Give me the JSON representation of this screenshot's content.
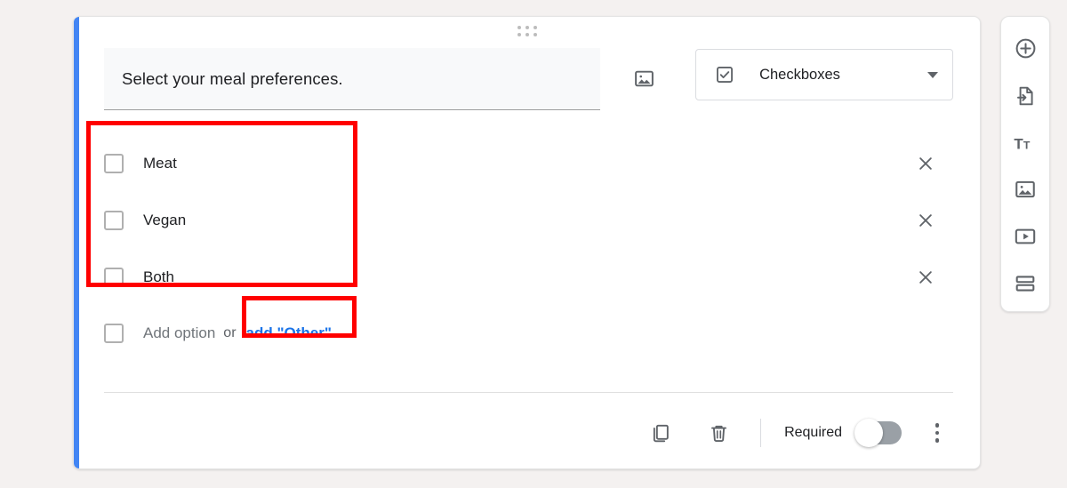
{
  "card": {
    "drag_handle_icon": "drag-dots-icon",
    "question": {
      "title": "Select your meal preferences.",
      "image_button_icon": "image-icon",
      "type_select": {
        "icon": "checkbox-icon",
        "value": "Checkboxes",
        "caret_icon": "chevron-down-icon"
      }
    },
    "options": [
      {
        "label": "Meat",
        "checked": false,
        "remove_icon": "close-icon"
      },
      {
        "label": "Vegan",
        "checked": false,
        "remove_icon": "close-icon"
      },
      {
        "label": "Both",
        "checked": false,
        "remove_icon": "close-icon"
      }
    ],
    "add_row": {
      "add_option_label": "Add option",
      "or_text": "or",
      "add_other_label": "add \"Other\""
    },
    "footer": {
      "duplicate_icon": "duplicate-icon",
      "delete_icon": "trash-icon",
      "required_label": "Required",
      "required_on": false,
      "more_icon": "more-vertical-icon"
    }
  },
  "sidebar": {
    "items": [
      {
        "name": "add-question",
        "icon": "plus-circle-icon"
      },
      {
        "name": "import-questions",
        "icon": "import-file-icon"
      },
      {
        "name": "add-title-and-description",
        "icon": "title-text-icon"
      },
      {
        "name": "add-image",
        "icon": "image-icon"
      },
      {
        "name": "add-video",
        "icon": "video-icon"
      },
      {
        "name": "add-section",
        "icon": "section-icon"
      }
    ]
  },
  "annotations": {
    "options_highlight_color": "#ff0000",
    "add_other_highlight_color": "#ff0000"
  },
  "theme": {
    "accent": "#4285f4",
    "link": "#1a73e8",
    "page_background": "#f4f1f0"
  }
}
